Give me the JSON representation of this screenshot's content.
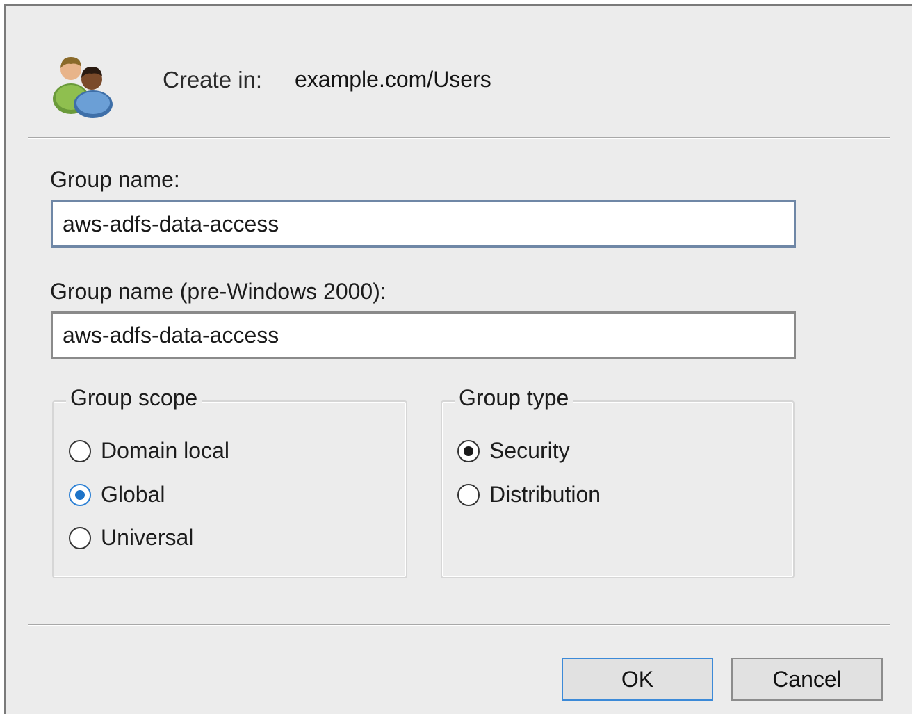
{
  "header": {
    "icon": "users-group-icon",
    "create_in_label": "Create in:",
    "create_in_value": "example.com/Users"
  },
  "form": {
    "group_name_label": "Group name:",
    "group_name_value": "aws-adfs-data-access",
    "pre2000_label": "Group name (pre-Windows 2000):",
    "pre2000_value": "aws-adfs-data-access"
  },
  "group_scope": {
    "title": "Group scope",
    "options": [
      {
        "label": "Domain local",
        "selected": false
      },
      {
        "label": "Global",
        "selected": true
      },
      {
        "label": "Universal",
        "selected": false
      }
    ]
  },
  "group_type": {
    "title": "Group type",
    "options": [
      {
        "label": "Security",
        "selected": true
      },
      {
        "label": "Distribution",
        "selected": false
      }
    ]
  },
  "buttons": {
    "ok_label": "OK",
    "cancel_label": "Cancel"
  },
  "colors": {
    "accent": "#1e74c8",
    "dialog_background": "#ececec"
  }
}
